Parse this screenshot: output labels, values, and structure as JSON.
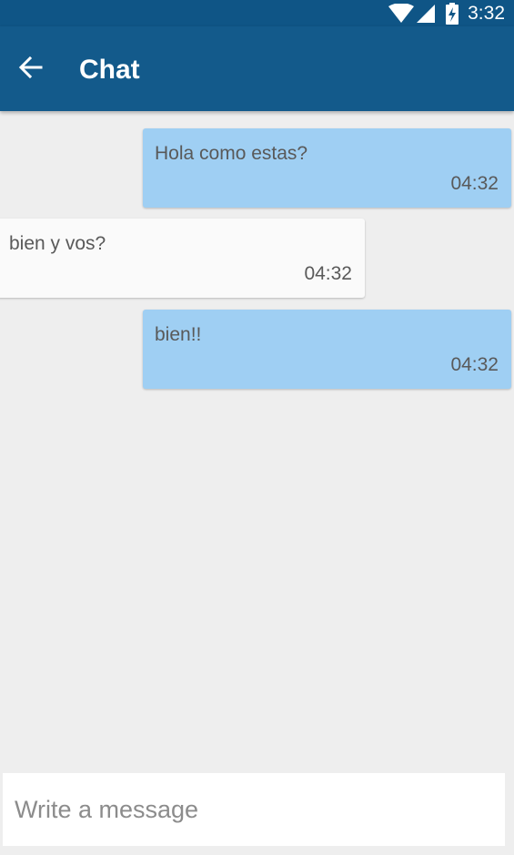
{
  "status_bar": {
    "time": "3:32",
    "icons": [
      "wifi-icon",
      "cell-signal-icon",
      "battery-charging-icon"
    ]
  },
  "app_bar": {
    "back_icon": "arrow-left-icon",
    "title": "Chat",
    "color": "#135a8b"
  },
  "messages": [
    {
      "direction": "outgoing",
      "text": "Hola como estas?",
      "time": "04:32"
    },
    {
      "direction": "incoming",
      "text": "bien y vos?",
      "time": "04:32"
    },
    {
      "direction": "outgoing",
      "text": "bien!!",
      "time": "04:32"
    }
  ],
  "colors": {
    "outgoing_bubble": "#9fcff3",
    "incoming_bubble": "#fafafa",
    "background": "#eeeeee"
  },
  "composer": {
    "placeholder": "Write a message",
    "value": ""
  }
}
